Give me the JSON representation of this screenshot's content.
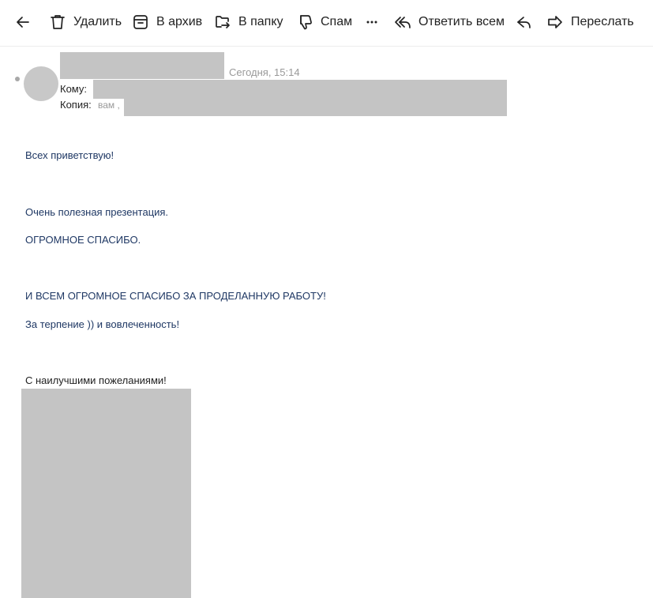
{
  "toolbar": {
    "back_icon": "arrow-left-icon",
    "delete_label": "Удалить",
    "delete_icon": "trash-icon",
    "archive_label": "В архив",
    "archive_icon": "archive-box-icon",
    "folder_label": "В папку",
    "folder_icon": "folder-move-icon",
    "spam_label": "Спам",
    "spam_icon": "thumbs-down-icon",
    "more_icon": "ellipsis-icon",
    "reply_all_label": "Ответить всем",
    "reply_all_icon": "reply-all-icon",
    "reply_icon": "reply-icon",
    "forward_label": "Переслать",
    "forward_icon": "forward-arrow-icon"
  },
  "header": {
    "date": "Сегодня, 15:14",
    "to_label": "Кому:",
    "cc_label": "Копия:",
    "cc_value": "вам ,"
  },
  "body": {
    "lines": [
      "Всех приветствую!",
      "Очень полезная презентация.",
      "ОГРОМНОЕ СПАСИБО.",
      "И ВСЕМ ОГРОМНОЕ СПАСИБО ЗА ПРОДЕЛАННУЮ РАБОТУ!",
      "За терпение )) и вовлеченность!",
      "С наилучшими пожеланиями!"
    ]
  },
  "colors": {
    "body_text": "#1f3864",
    "redaction": "#c4c4c4",
    "muted": "#999999"
  }
}
